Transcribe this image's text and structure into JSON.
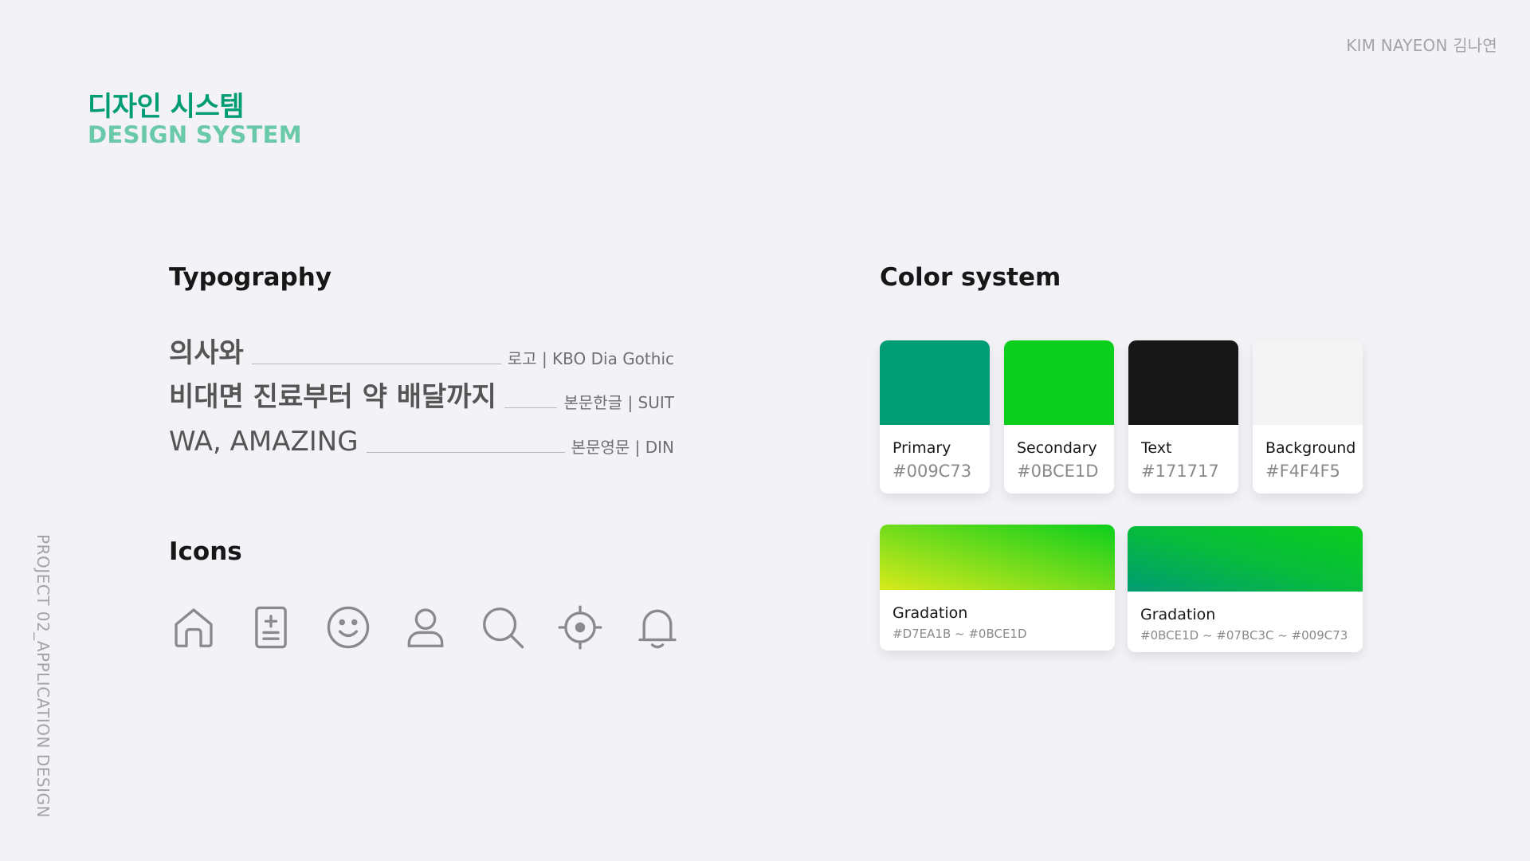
{
  "header": {
    "author": "KIM NAYEON 김나연",
    "title_ko": "디자인 시스템",
    "title_en": "DESIGN SYSTEM",
    "side_label": "PROJECT 02_APPLICATION DESIGN"
  },
  "typography": {
    "title": "Typography",
    "rows": [
      {
        "sample": "의사와",
        "font": "로고 | KBO Dia Gothic"
      },
      {
        "sample": "비대면 진료부터 약 배달까지",
        "font": "본문한글 | SUIT"
      },
      {
        "sample": "WA, AMAZING",
        "font": "본문영문 | DIN"
      }
    ]
  },
  "icons_section": {
    "title": "Icons",
    "icons": [
      "home-icon",
      "document-add-icon",
      "smile-icon",
      "user-icon",
      "search-icon",
      "location-target-icon",
      "bell-icon"
    ],
    "icon_color": "#8a8a8e"
  },
  "colors": {
    "title": "Color system",
    "swatches": [
      {
        "name": "Primary",
        "hex": "#009C73",
        "color": "#009C73"
      },
      {
        "name": "Secondary",
        "hex": "#0BCE1D",
        "color": "#0BCE1D"
      },
      {
        "name": "Text",
        "hex": "#171717",
        "color": "#171717"
      },
      {
        "name": "Background",
        "hex": "#F4F4F5",
        "color": "#F4F4F5"
      }
    ],
    "gradients": [
      {
        "name": "Gradation",
        "hex": "#D7EA1B ~ #0BCE1D",
        "stops": [
          "#D7EA1B",
          "#0BCE1D"
        ]
      },
      {
        "name": "Gradation",
        "hex": "#0BCE1D ~ #07BC3C ~ #009C73",
        "stops": [
          "#0BCE1D",
          "#07BC3C",
          "#009C73"
        ]
      }
    ]
  }
}
